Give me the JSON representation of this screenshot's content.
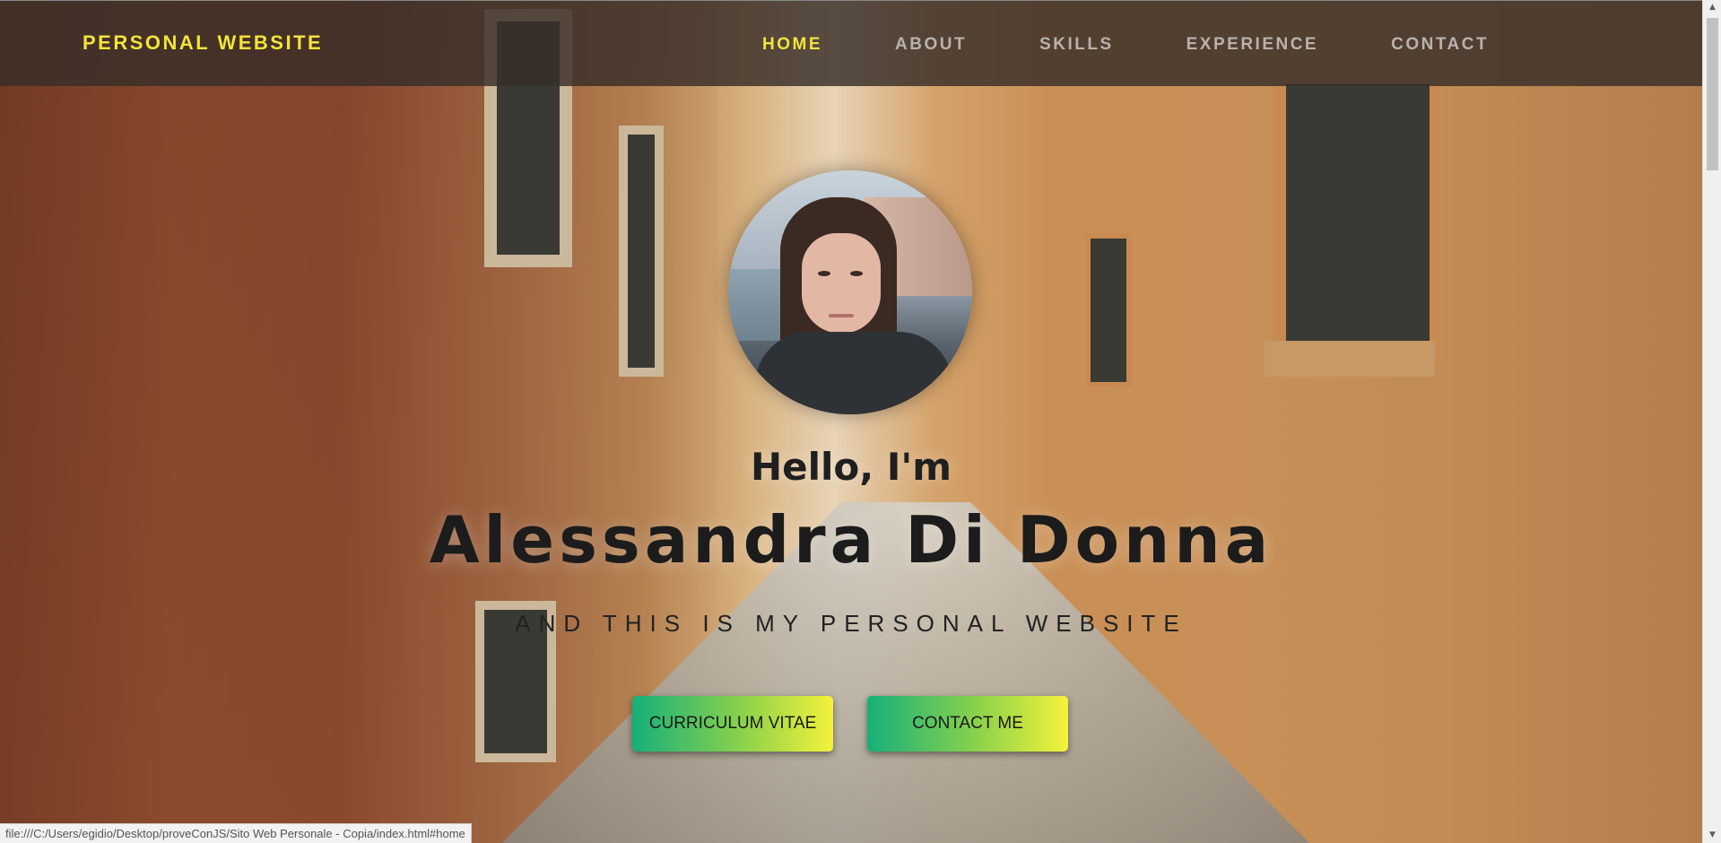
{
  "navbar": {
    "brand": "PERSONAL WEBSITE",
    "links": [
      {
        "label": "HOME",
        "active": true
      },
      {
        "label": "ABOUT",
        "active": false
      },
      {
        "label": "SKILLS",
        "active": false
      },
      {
        "label": "EXPERIENCE",
        "active": false
      },
      {
        "label": "CONTACT",
        "active": false
      }
    ]
  },
  "hero": {
    "greeting": "Hello, I'm",
    "name": "Alessandra Di Donna",
    "subtitle": "AND THIS IS MY PERSONAL WEBSITE",
    "buttons": {
      "cv_label": "CURRICULUM VITAE",
      "contact_label": "CONTACT ME"
    }
  },
  "status_bar": {
    "url": "file:///C:/Users/egidio/Desktop/proveConJS/Sito Web Personale - Copia/index.html#home"
  },
  "colors": {
    "accent": "#f2e43a",
    "nav_text": "#b9b2ac",
    "button_gradient_start": "#16b07a",
    "button_gradient_end": "#f4f23a"
  }
}
